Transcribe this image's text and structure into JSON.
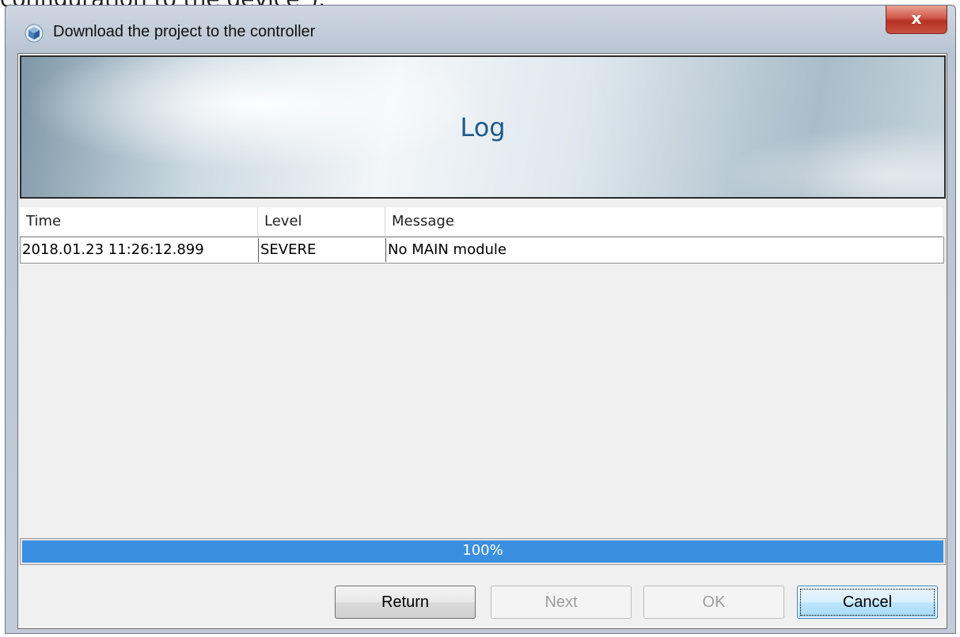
{
  "background_caption": "configuration to the device\").",
  "window": {
    "title": "Download the project to the controller",
    "close_label": "x"
  },
  "banner": {
    "title": "Log"
  },
  "log_table": {
    "columns": [
      "Time",
      "Level",
      "Message"
    ],
    "rows": [
      {
        "time": "2018.01.23 11:26:12.899",
        "level": "SEVERE",
        "message": "No MAIN module"
      }
    ]
  },
  "progress": {
    "value_percent": 100,
    "label": "100%"
  },
  "buttons": {
    "return": "Return",
    "next": "Next",
    "ok": "OK",
    "cancel": "Cancel"
  },
  "colors": {
    "progress_fill": "#3a8fe0",
    "banner_title": "#1f5a8c",
    "close_button": "#c9503f"
  },
  "icons": {
    "app": "cube-icon",
    "close": "close-icon"
  }
}
